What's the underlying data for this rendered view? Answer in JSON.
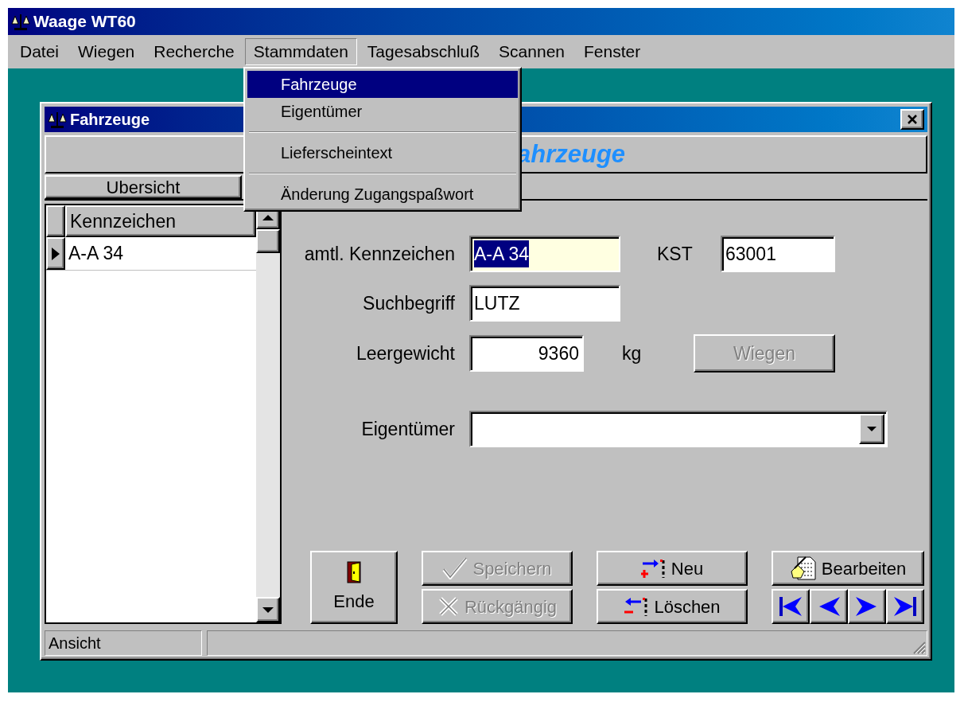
{
  "window": {
    "title": "Waage WT60"
  },
  "menu_bar": [
    {
      "label": "Datei",
      "selected": false
    },
    {
      "label": "Wiegen",
      "selected": false
    },
    {
      "label": "Recherche",
      "selected": false
    },
    {
      "label": "Stammdaten",
      "selected": true
    },
    {
      "label": "Tagesabschluß",
      "selected": false
    },
    {
      "label": "Scannen",
      "selected": false
    },
    {
      "label": "Fenster",
      "selected": false
    }
  ],
  "open_menu": [
    {
      "kind": "item",
      "label": "Fahrzeuge",
      "selected": true
    },
    {
      "kind": "item",
      "label": "Eigentümer",
      "selected": false
    },
    {
      "kind": "separator"
    },
    {
      "kind": "item",
      "label": "Lieferscheintext",
      "selected": false
    },
    {
      "kind": "separator"
    },
    {
      "kind": "item",
      "label": "Änderung Zugangspaßwort",
      "selected": false
    }
  ],
  "child_window": {
    "title": "Fahrzeuge",
    "header": "ahrzeuge",
    "panel_title": "Ubersicht",
    "grid": {
      "columns": [
        "Kennzeichen"
      ],
      "rows": [
        {
          "cells": [
            "A-A 34"
          ],
          "selected": true
        }
      ]
    },
    "form": {
      "kennzeichen": {
        "label": "amtl. Kennzeichen",
        "value": "A-A 34",
        "focused": true
      },
      "kst": {
        "label": "KST",
        "value": "63001",
        "focused": false
      },
      "suchbegriff": {
        "label": "Suchbegriff",
        "value": "LUTZ",
        "focused": false
      },
      "leergewicht": {
        "label": "Leergewicht",
        "value": "9360",
        "unit": "kg",
        "focused": false
      },
      "wiegen_button": {
        "label": "Wiegen",
        "disabled": true
      },
      "eigentuemer": {
        "label": "Eigentümer"
      }
    },
    "button_groups": [
      {
        "buttons": [
          {
            "kind": "ende",
            "label": "Ende",
            "disabled": false
          }
        ]
      },
      {
        "buttons": [
          {
            "kind": "speichern",
            "label": "Speichern",
            "disabled": true
          },
          {
            "kind": "rueckgaengig",
            "label": "Rückgängig",
            "disabled": true
          }
        ]
      },
      {
        "buttons": [
          {
            "kind": "neu",
            "label": "Neu",
            "disabled": false
          },
          {
            "kind": "loeschen",
            "label": "Löschen",
            "disabled": false
          }
        ]
      },
      {
        "buttons": [
          {
            "kind": "bearbeiten",
            "label": "Bearbeiten",
            "disabled": false
          }
        ]
      }
    ],
    "status_bar": [
      "Ansicht"
    ]
  }
}
